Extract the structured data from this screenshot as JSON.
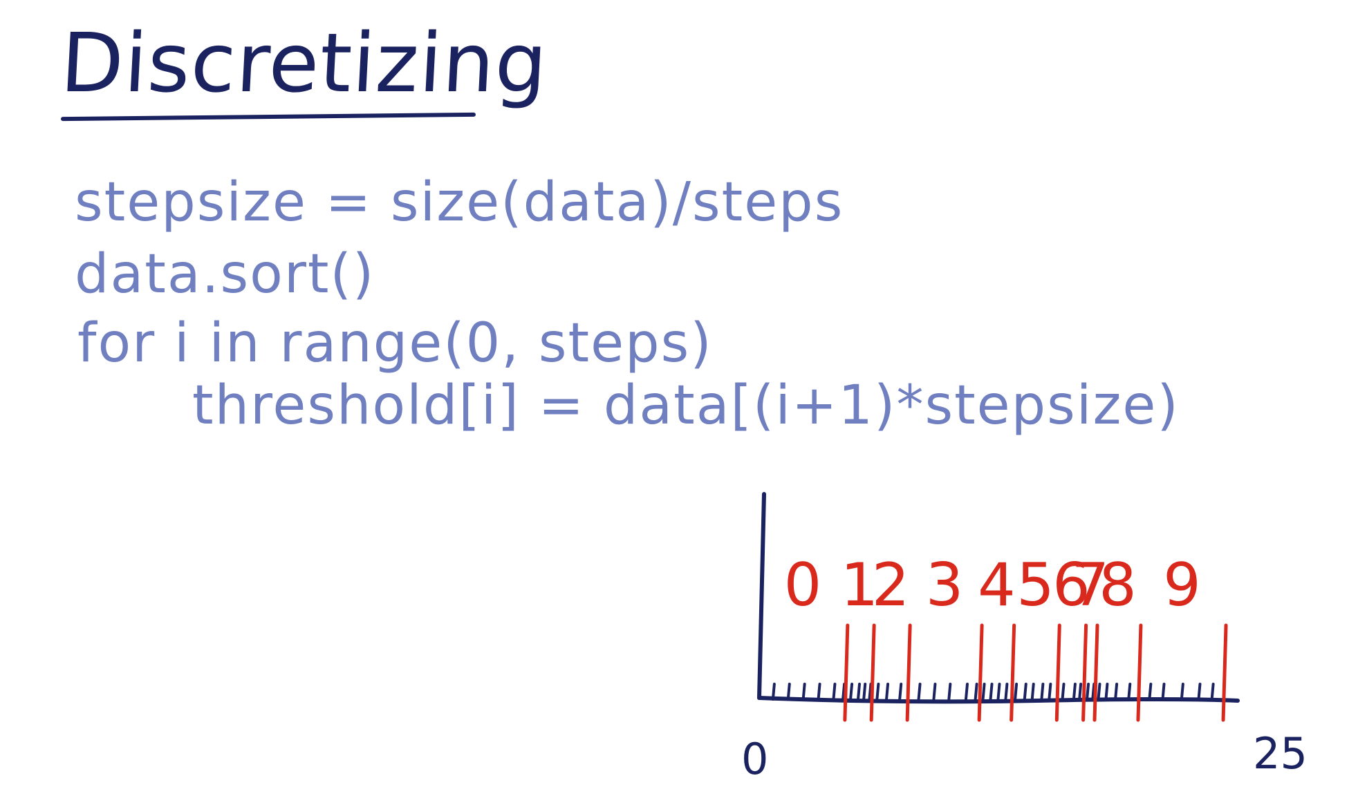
{
  "title": "Discretizing",
  "code_lines": [
    "stepsize = size(data)/steps",
    "data.sort()",
    "for i in range(0, steps)",
    "threshold[i] = data[(i+1)*stepsize)"
  ],
  "axis": {
    "min_label": "0",
    "max_label": "25",
    "min": 0,
    "max": 25
  },
  "bin_labels": [
    "0",
    "1",
    "2",
    "3",
    "4",
    "5",
    "6",
    "7",
    "8",
    "9"
  ],
  "thresholds": [
    4.6,
    6.0,
    7.9,
    11.7,
    13.4,
    15.8,
    17.2,
    17.8,
    20.1,
    24.6
  ],
  "data_ticks": [
    0.8,
    1.6,
    2.4,
    3.2,
    4.0,
    4.5,
    4.9,
    5.3,
    5.6,
    5.9,
    6.3,
    6.8,
    7.5,
    8.5,
    9.3,
    10.1,
    11.0,
    11.5,
    11.9,
    12.3,
    12.7,
    13.1,
    13.6,
    14.1,
    14.5,
    15.0,
    15.4,
    16.1,
    16.7,
    17.0,
    17.4,
    17.7,
    18.0,
    18.4,
    18.9,
    19.6,
    20.7,
    21.4,
    22.4,
    23.3,
    24.0
  ],
  "colors": {
    "ink": "#1b2260",
    "code": "#6f7fc0",
    "threshold": "#d9281c"
  }
}
